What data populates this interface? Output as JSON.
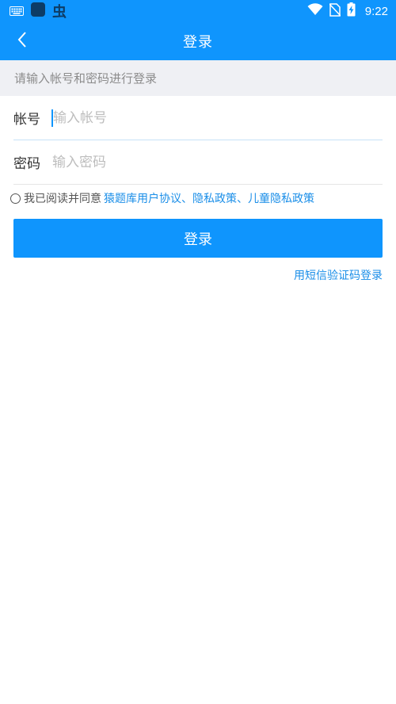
{
  "status_bar": {
    "left_icons": [
      "keyboard-icon",
      "app-square-icon",
      "app-chong-icon"
    ],
    "app_glyph": "虫",
    "right_icons": [
      "wifi-icon",
      "no-sim-icon",
      "battery-charging-icon"
    ],
    "time": "9:22"
  },
  "header": {
    "back_icon": "chevron-left-icon",
    "title": "登录"
  },
  "hint": "请输入帐号和密码进行登录",
  "form": {
    "account_label": "帐号",
    "account_placeholder": "输入帐号",
    "account_value": "",
    "password_label": "密码",
    "password_placeholder": "输入密码",
    "password_value": ""
  },
  "agreement": {
    "prefix": "我已阅读并同意",
    "link1": "猿题库用户协议",
    "sep1": "、",
    "link2": "隐私政策",
    "sep2": "、",
    "link3": "儿童隐私政策"
  },
  "login_button": "登录",
  "sms_login": "用短信验证码登录",
  "colors": {
    "primary": "#0f95fd",
    "link": "#1a8ee8",
    "hint_bg": "#eff0f4"
  }
}
